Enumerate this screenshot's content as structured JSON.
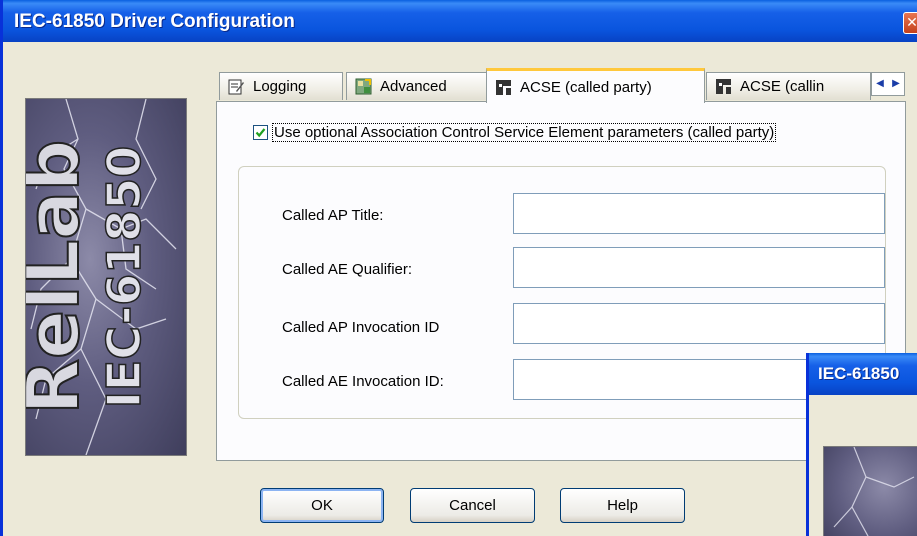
{
  "window": {
    "title": "IEC-61850 Driver Configuration",
    "close_glyph": "✕"
  },
  "banner": {
    "logo_text_1": "RelLab",
    "logo_text_2": "IEC-61850"
  },
  "tabs": [
    {
      "label": "Logging",
      "icon": "logging-icon"
    },
    {
      "label": "Advanced",
      "icon": "advanced-icon"
    },
    {
      "label": "ACSE (called party)",
      "icon": "acse-icon",
      "active": true
    },
    {
      "label": "ACSE (callin",
      "icon": "acse-icon"
    }
  ],
  "tab_scroll": {
    "left": "◀",
    "right": "▶"
  },
  "option": {
    "label": "Use optional Association Control Service Element parameters (called party)",
    "checked": true
  },
  "fields": [
    {
      "label": "Called AP Title:",
      "value": ""
    },
    {
      "label": "Called AE Qualifier:",
      "value": ""
    },
    {
      "label": "Called AP Invocation ID",
      "value": ""
    },
    {
      "label": "Called AE Invocation ID:",
      "value": ""
    }
  ],
  "buttons": {
    "ok": "OK",
    "cancel": "Cancel",
    "help": "Help"
  },
  "overlay": {
    "title": "IEC-61850"
  },
  "colors": {
    "titlebar": "#0A55DE",
    "active_tab_highlight": "#FFC83C",
    "window_bg": "#ECE9D8"
  }
}
